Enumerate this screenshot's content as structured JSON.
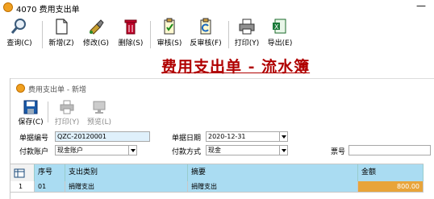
{
  "window": {
    "title": "4070 费用支出单",
    "minimize": "—"
  },
  "toolbar": {
    "query": "查询(C)",
    "new": "新增(Z)",
    "edit": "修改(G)",
    "delete": "删除(S)",
    "audit": "审核(S)",
    "unaudit": "反审核(F)",
    "print": "打印(Y)",
    "export": "导出(E)"
  },
  "banner_title": "费用支出单 - 流水簿",
  "child_window": {
    "title": "费用支出单 - 新增",
    "toolbar": {
      "save": "保存(C)",
      "print": "打印(Y)",
      "preview": "预览(L)"
    },
    "form": {
      "doc_no_label": "单据编号",
      "doc_no_value": "QZC-20120001",
      "doc_date_label": "单据日期",
      "doc_date_value": "2020-12-31",
      "pay_account_label": "付款账户",
      "pay_account_value": "现金账户",
      "pay_method_label": "付款方式",
      "pay_method_value": "现金",
      "ticket_no_label": "票号",
      "ticket_no_value": ""
    },
    "grid": {
      "headers": [
        "序号",
        "支出类别",
        "摘要",
        "金额"
      ],
      "rows": [
        {
          "row_num": "1",
          "seq": "01",
          "category": "捐赠支出",
          "summary": "捐赠支出",
          "amount": "800.00"
        }
      ]
    }
  },
  "colors": {
    "accent": "#b00000",
    "grid_header": "#aadcf2",
    "amount_highlight": "#e8a43a",
    "field_bg": "#dff0fb"
  }
}
